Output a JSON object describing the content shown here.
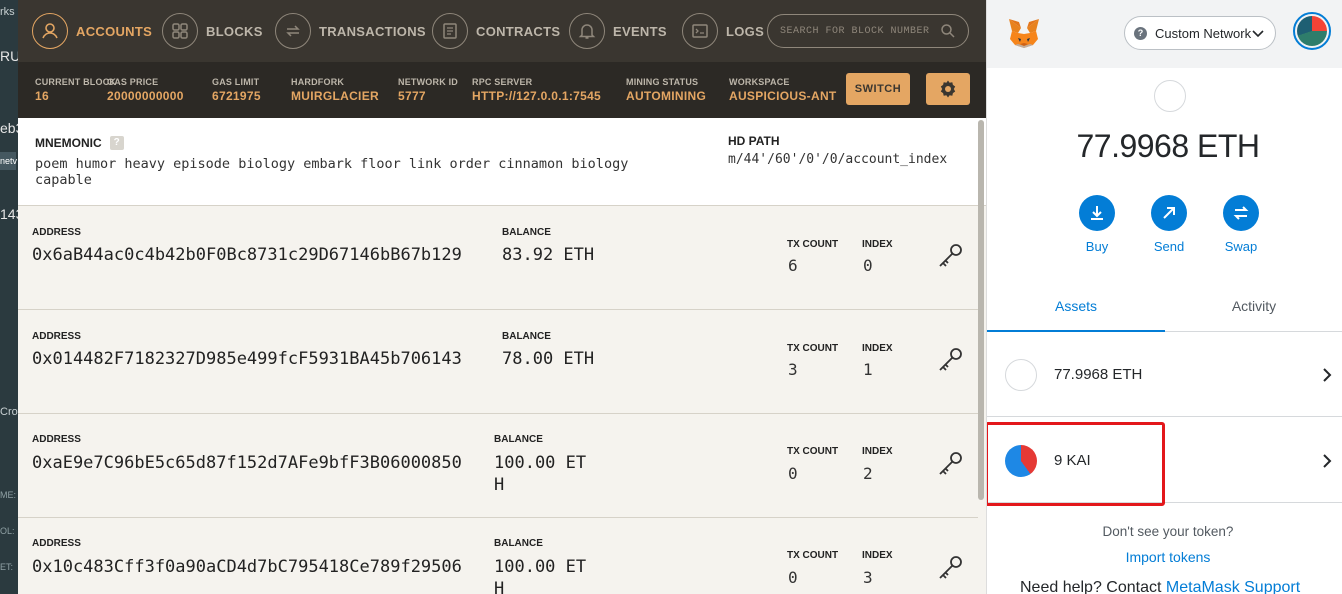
{
  "background_app": {
    "fragments": [
      "rks",
      "RU",
      "eb3",
      "netv",
      "143",
      "Crov",
      "ME:",
      "OL:",
      "ET:"
    ]
  },
  "ganache": {
    "nav": [
      {
        "label": "ACCOUNTS",
        "icon": "account-icon",
        "active": true
      },
      {
        "label": "BLOCKS",
        "icon": "blocks-icon",
        "active": false
      },
      {
        "label": "TRANSACTIONS",
        "icon": "transactions-icon",
        "active": false
      },
      {
        "label": "CONTRACTS",
        "icon": "contracts-icon",
        "active": false
      },
      {
        "label": "EVENTS",
        "icon": "bell-icon",
        "active": false
      },
      {
        "label": "LOGS",
        "icon": "logs-icon",
        "active": false
      }
    ],
    "search_placeholder": "SEARCH FOR BLOCK NUMBERS OR TX HASHES",
    "status": {
      "current_block_label": "CURRENT BLOCK",
      "current_block": "16",
      "gas_price_label": "GAS PRICE",
      "gas_price": "20000000000",
      "gas_limit_label": "GAS LIMIT",
      "gas_limit": "6721975",
      "hardfork_label": "HARDFORK",
      "hardfork": "MUIRGLACIER",
      "network_id_label": "NETWORK ID",
      "network_id": "5777",
      "rpc_label": "RPC SERVER",
      "rpc": "HTTP://127.0.0.1:7545",
      "mining_label": "MINING STATUS",
      "mining": "AUTOMINING",
      "workspace_label": "WORKSPACE",
      "workspace": "AUSPICIOUS-ANT",
      "switch_label": "SWITCH"
    },
    "mnemonic_label": "MNEMONIC",
    "mnemonic_help": "?",
    "mnemonic": "poem humor heavy episode biology embark floor link order cinnamon biology capable",
    "hd_path_label": "HD PATH",
    "hd_path": "m/44'/60'/0'/0/account_index",
    "col_address": "ADDRESS",
    "col_balance": "BALANCE",
    "col_tx": "TX COUNT",
    "col_index": "INDEX",
    "accounts": [
      {
        "address": "0x6aB44ac0c4b42b0F0Bc8731c29D67146bB67b129",
        "balance": "83.92 ETH",
        "tx_count": "6",
        "index": "0"
      },
      {
        "address": "0x014482F7182327D985e499fcF5931BA45b706143",
        "balance": "78.00 ETH",
        "tx_count": "3",
        "index": "1"
      },
      {
        "address": "0xaE9e7C96bE5c65d87f152d7AFe9bfF3B06000850",
        "balance": "100.00 ETH",
        "tx_count": "0",
        "index": "2"
      },
      {
        "address": "0x10c483Cff3f0a90aCD4d7bC795418Ce789f29506",
        "balance": "100.00 ETH",
        "tx_count": "0",
        "index": "3"
      }
    ]
  },
  "metamask": {
    "network": "Custom Network",
    "balance": "77.9968 ETH",
    "actions": [
      "Buy",
      "Send",
      "Swap"
    ],
    "tabs": [
      "Assets",
      "Activity"
    ],
    "active_tab": "Assets",
    "assets": [
      {
        "name": "77.9968 ETH",
        "icon": "eth-token-icon"
      },
      {
        "name": "9 KAI",
        "icon": "kai-token-icon"
      }
    ],
    "dont_see": "Don't see your token?",
    "import_tokens": "Import tokens",
    "help_prefix": "Need help? Contact",
    "help_link": "MetaMask Support",
    "accent": "#037dd6",
    "highlight_color": "#e3171b"
  }
}
